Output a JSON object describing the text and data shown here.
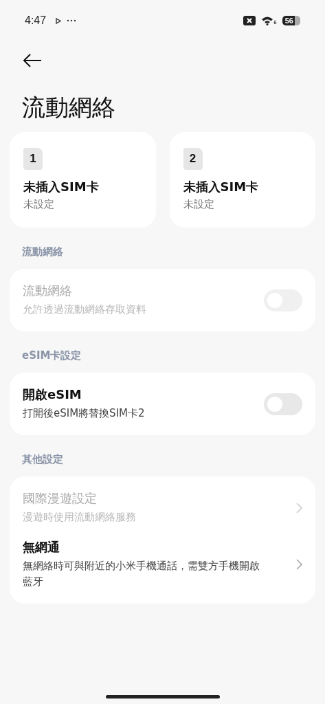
{
  "status_bar": {
    "time": "4:47",
    "wifi_badge": "6",
    "battery": "56"
  },
  "title": "流動網絡",
  "sim_cards": [
    {
      "number": "1",
      "name": "未插入SIM卡",
      "status": "未設定"
    },
    {
      "number": "2",
      "name": "未插入SIM卡",
      "status": "未設定"
    }
  ],
  "groups": [
    {
      "header": "流動網絡",
      "rows": [
        {
          "kind": "toggle",
          "title": "流動網絡",
          "subtitle": "允許透過流動網絡存取資料",
          "disabled": true,
          "on": false
        }
      ]
    },
    {
      "header": "eSIM卡設定",
      "rows": [
        {
          "kind": "toggle",
          "title": "開啟eSIM",
          "subtitle": "打開後eSIM將替換SIM卡2",
          "disabled": false,
          "on": false
        }
      ]
    },
    {
      "header": "其他設定",
      "rows": [
        {
          "kind": "link",
          "title": "國際漫遊設定",
          "subtitle": "漫遊時使用流動網絡服務",
          "disabled": true
        },
        {
          "kind": "link",
          "title": "無網通",
          "subtitle": "無網絡時可與附近的小米手機通話，需雙方手機開啟藍牙",
          "disabled": false
        }
      ]
    }
  ]
}
